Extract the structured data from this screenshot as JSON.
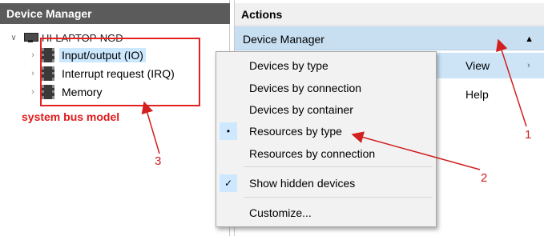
{
  "left_pane": {
    "header": "Device Manager",
    "root": {
      "label": "HI-LAPTOP-NGD",
      "icon": "computer-icon",
      "expanded": true
    },
    "items": [
      {
        "label": "Input/output (IO)",
        "icon": "chip-icon",
        "selected": true
      },
      {
        "label": "Interrupt request (IRQ)",
        "icon": "chip-icon",
        "selected": false
      },
      {
        "label": "Memory",
        "icon": "chip-icon",
        "selected": false
      }
    ]
  },
  "annotations": {
    "caption": "system bus model",
    "numbers": [
      "1",
      "2",
      "3"
    ],
    "color": "#e01b1b"
  },
  "right_pane": {
    "header": "Actions",
    "device_manager_row": "Device Manager",
    "view": "View",
    "help": "Help"
  },
  "context_menu": {
    "items": [
      {
        "label": "Devices by type",
        "mark": ""
      },
      {
        "label": "Devices by connection",
        "mark": ""
      },
      {
        "label": "Devices by container",
        "mark": ""
      },
      {
        "label": "Resources by type",
        "mark": "•"
      },
      {
        "label": "Resources by connection",
        "mark": ""
      },
      {
        "label": "Show hidden devices",
        "mark": "✓"
      },
      {
        "label": "Customize...",
        "mark": ""
      }
    ]
  },
  "colors": {
    "header_dark": "#5b5b5b",
    "selection": "#cce8ff",
    "action_highlight": "#c8dff2",
    "annotation_red": "#e32222"
  }
}
